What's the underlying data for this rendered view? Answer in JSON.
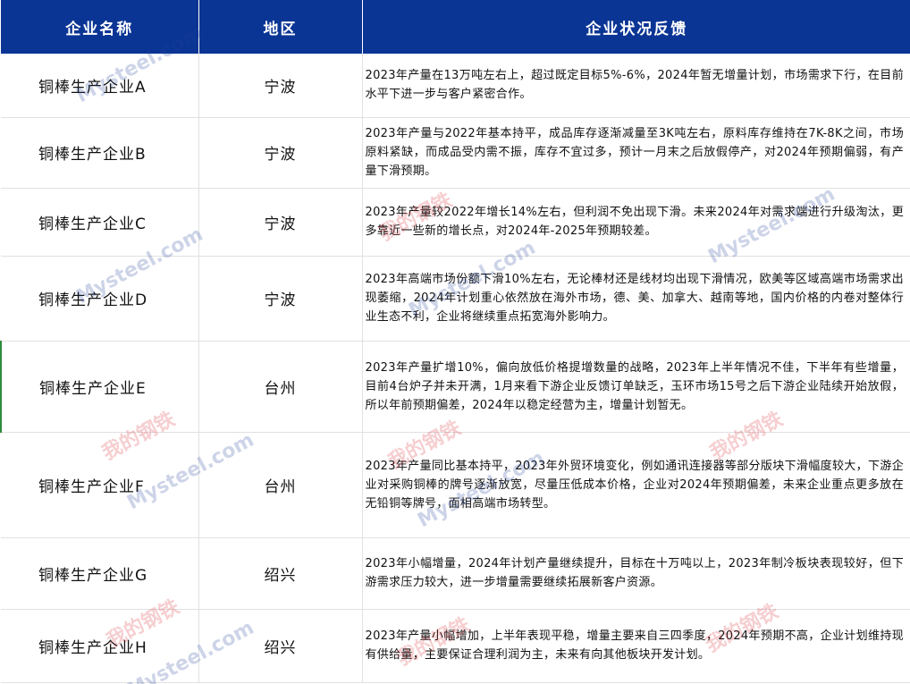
{
  "table": {
    "headers": [
      "企业名称",
      "地区",
      "企业状况反馈"
    ],
    "rows": [
      {
        "name": "铜棒生产企业A",
        "region": "宁波",
        "feedback": "2023年产量在13万吨左右上，超过既定目标5%-6%，2024年暂无增量计划，市场需求下行，在目前水平下进一步与客户紧密合作。"
      },
      {
        "name": "铜棒生产企业B",
        "region": "宁波",
        "feedback": "2023年产量与2022年基本持平，成品库存逐渐减量至3K吨左右，原料库存维持在7K-8K之间，市场原料紧缺，而成品受内需不振，库存不宜过多，预计一月末之后放假停产，对2024年预期偏弱，有产量下滑预期。"
      },
      {
        "name": "铜棒生产企业C",
        "region": "宁波",
        "feedback": "2023年产量较2022年增长14%左右，但利润不免出现下滑。未来2024年对需求端进行升级淘汰，更多靠近一些新的增长点，对2024年-2025年预期较差。"
      },
      {
        "name": "铜棒生产企业D",
        "region": "宁波",
        "feedback": "2023年高端市场份额下滑10%左右，无论棒材还是线材均出现下滑情况，欧美等区域高端市场需求出现萎缩，2024年计划重心依然放在海外市场，德、美、加拿大、越南等地，国内价格的内卷对整体行业生态不利，企业将继续重点拓宽海外影响力。"
      },
      {
        "name": "铜棒生产企业E",
        "region": "台州",
        "feedback": "2023年产量扩增10%，偏向放低价格提增数量的战略，2023年上半年情况不佳，下半年有些增量，目前4台炉子并未开满，1月来看下游企业反馈订单缺乏，玉环市场15号之后下游企业陆续开始放假，所以年前预期偏差，2024年以稳定经营为主，增量计划暂无。"
      },
      {
        "name": "铜棒生产企业F",
        "region": "台州",
        "feedback": "2023年产量同比基本持平，2023年外贸环境变化，例如通讯连接器等部分版块下滑幅度较大，下游企业对采购铜棒的牌号逐渐放宽，尽量压低成本价格，企业对2024年预期偏差，未来企业重点更多放在无铅铜等牌号，面相高端市场转型。"
      },
      {
        "name": "铜棒生产企业G",
        "region": "绍兴",
        "feedback": "2023年小幅增量，2024年计划产量继续提升，目标在十万吨以上，2023年制冷板块表现较好，但下游需求压力较大，进一步增量需要继续拓展新客户资源。"
      },
      {
        "name": "铜棒生产企业H",
        "region": "绍兴",
        "feedback": "2023年产量小幅增加，上半年表现平稳，增量主要来自三四季度，2024年预期不高，企业计划维持现有供给量，主要保证合理利润为主，未来有向其他板块开发计划。"
      }
    ]
  },
  "watermark": {
    "cn": "我的钢铁",
    "en": "Mysteel.com"
  }
}
